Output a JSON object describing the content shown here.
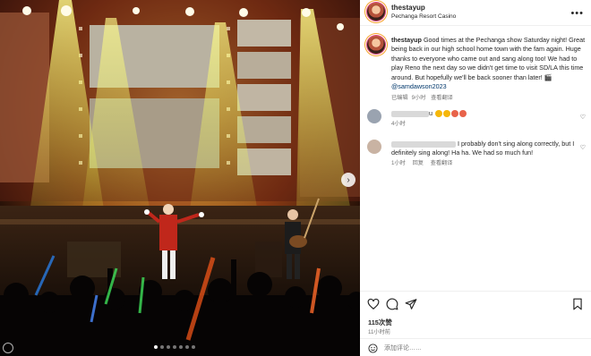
{
  "post": {
    "username": "thestayup",
    "location": "Pechanga Resort Casino",
    "caption": "Good times at the Pechanga show Saturday night! Great being back in our high school home town with the fam again. Huge thanks to everyone who came out and sang along too! We had to play Reno the next day so we didn't get time to visit SD/LA this time around. But hopefully we'll be back sooner than later! 🎬",
    "mention": "@samdawson2023",
    "edited_label": "已编辑",
    "caption_age": "9小时",
    "translate_label": "查看翻译"
  },
  "comments": [
    {
      "text_visible": "u",
      "age": "4小时",
      "reply_label": "",
      "translate_label": ""
    },
    {
      "text_visible": "I probably don't sing along correctly, but I definitely sing along! Ha ha. We had so much fun!",
      "age": "1小时",
      "reply_label": "回复",
      "translate_label": "查看翻译"
    }
  ],
  "footer": {
    "likes": "115次赞",
    "time": "11小时前",
    "comment_placeholder": "添加评论……"
  },
  "icons": {
    "more": "more-icon",
    "next": "chevron-right-icon",
    "like": "heart-icon",
    "comment": "comment-icon",
    "share": "send-icon",
    "save": "bookmark-icon",
    "emoji": "smiley-icon"
  },
  "colors": {
    "link": "#00376b",
    "muted": "#737373",
    "text": "#262626",
    "story_ring": "#e0427a"
  }
}
